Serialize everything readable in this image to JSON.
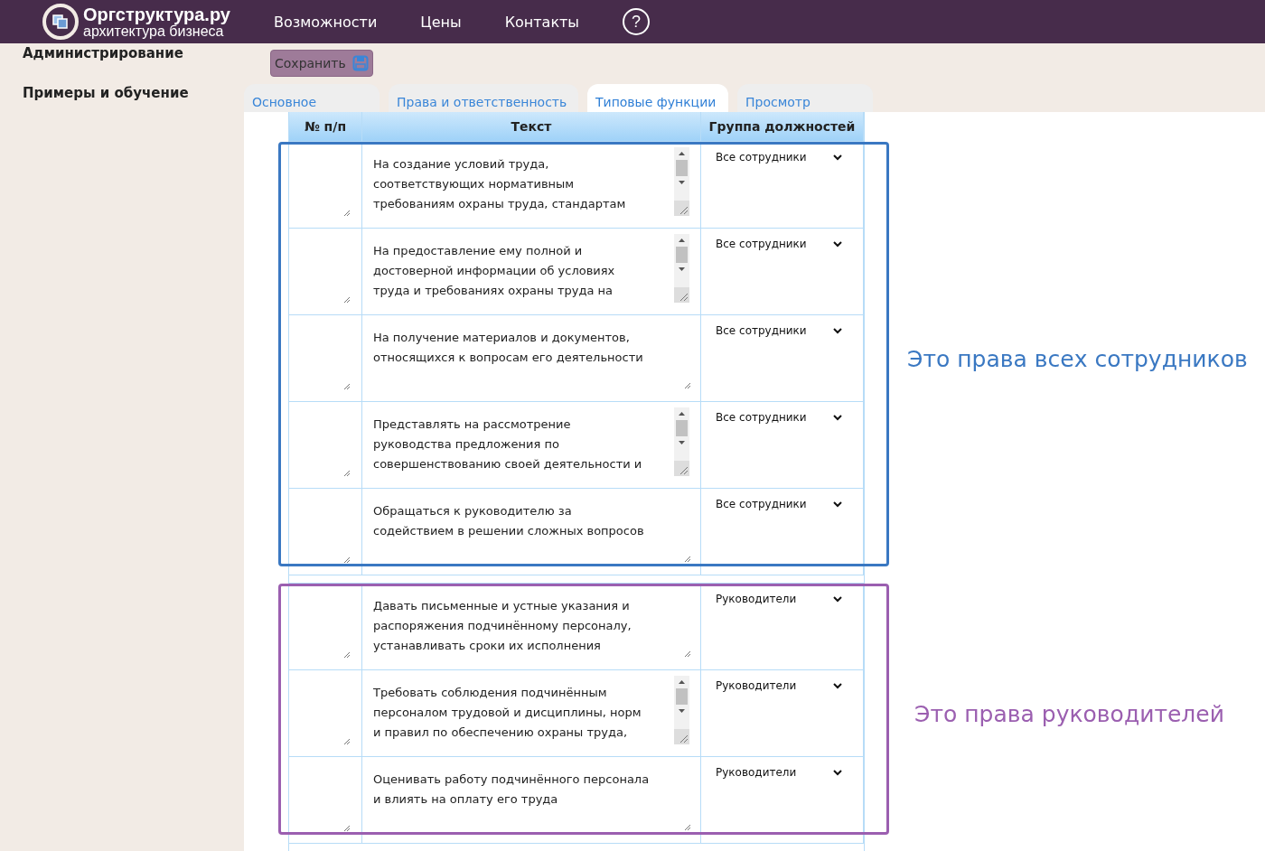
{
  "header": {
    "logo_title": "Оргструктура.ру",
    "logo_subtitle": "архитектура бизнеса",
    "nav": [
      "Возможности",
      "Цены",
      "Контакты"
    ],
    "help": "?"
  },
  "sidebar": {
    "items": [
      "Администрирование",
      "Примеры и обучение"
    ]
  },
  "save_button": "Сохранить",
  "tabs": [
    {
      "label": "Основное",
      "selected": false
    },
    {
      "label": "Права и ответственность",
      "selected": false
    },
    {
      "label": "Типовые функции",
      "selected": true
    },
    {
      "label": "Просмотр",
      "selected": false
    }
  ],
  "table": {
    "columns": [
      "№ п/п",
      "Текст",
      "Группа должностей"
    ],
    "groups": [
      {
        "annotation": "Это права всех сотрудников",
        "color": "#3a78c2",
        "rows": [
          {
            "text": "На создание условий труда, соответствующих нормативным требованиям охраны труда, стандартам",
            "scrollbar": true,
            "group": "Все сотрудники"
          },
          {
            "text": "На предоставление ему полной и достоверной информации об условиях труда и требованиях охраны труда на",
            "scrollbar": true,
            "group": "Все сотрудники"
          },
          {
            "text": "На получение материалов и документов, относящихся к вопросам его деятельности",
            "scrollbar": false,
            "group": "Все сотрудники"
          },
          {
            "text": "Представлять на рассмотрение руководства предложения по совершенствованию своей деятельности и",
            "scrollbar": true,
            "group": "Все сотрудники"
          },
          {
            "text": "Обращаться к руководителю за содействием в решении сложных вопросов",
            "scrollbar": false,
            "group": "Все сотрудники"
          }
        ]
      },
      {
        "annotation": "Это права руководителей",
        "color": "#9b5fb0",
        "rows": [
          {
            "text": "Давать письменные и устные указания и распоряжения подчинённому персоналу, устанавливать сроки их исполнения",
            "scrollbar": false,
            "group": "Руководители"
          },
          {
            "text": "Требовать соблюдения подчинённым персоналом трудовой и дисциплины, норм и правил по обеспечению охраны труда,",
            "scrollbar": true,
            "group": "Руководители"
          },
          {
            "text": "Оценивать работу подчинённого персонала и влиять на оплату его труда",
            "scrollbar": false,
            "group": "Руководители"
          }
        ]
      }
    ]
  }
}
